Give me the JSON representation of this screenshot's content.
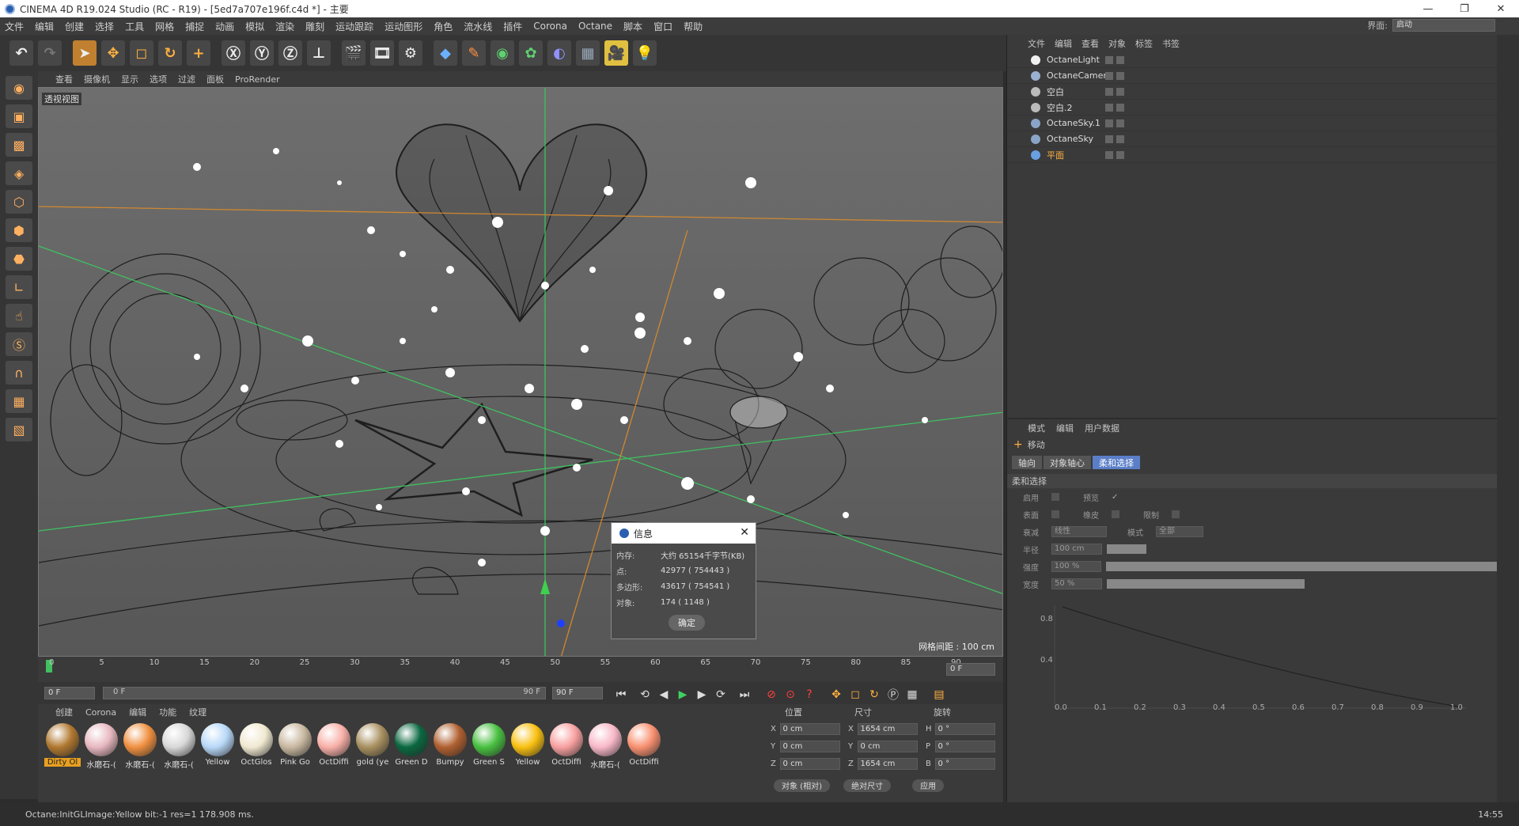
{
  "window": {
    "title": "CINEMA 4D R19.024 Studio (RC - R19) - [5ed7a707e196f.c4d *] - 主要"
  },
  "menubar": [
    "文件",
    "编辑",
    "创建",
    "选择",
    "工具",
    "网格",
    "捕捉",
    "动画",
    "模拟",
    "渲染",
    "雕刻",
    "运动跟踪",
    "运动图形",
    "角色",
    "流水线",
    "插件",
    "Corona",
    "Octane",
    "脚本",
    "窗口",
    "帮助"
  ],
  "layout": {
    "label": "界面:",
    "value": "启动"
  },
  "viewport": {
    "menu": [
      "查看",
      "摄像机",
      "显示",
      "选项",
      "过滤",
      "面板",
      "ProRender"
    ],
    "label": "透视视图",
    "grid_spacing": "网格间距 : 100 cm"
  },
  "info_dialog": {
    "title": "信息",
    "rows": [
      {
        "key": "内存:",
        "value": "大约 65154千字节(KB)"
      },
      {
        "key": "点:",
        "value": "42977 ( 754443 )"
      },
      {
        "key": "多边形:",
        "value": "43617 ( 754541 )"
      },
      {
        "key": "对象:",
        "value": "174 ( 1148 )"
      }
    ],
    "ok": "确定"
  },
  "timeline": {
    "ticks": [
      "0",
      "5",
      "10",
      "15",
      "20",
      "25",
      "30",
      "35",
      "40",
      "45",
      "50",
      "55",
      "60",
      "65",
      "70",
      "75",
      "80",
      "85",
      "90"
    ],
    "current": "0 F",
    "start": "0 F",
    "range_start": "0 F",
    "range_end": "90 F",
    "end": "90 F"
  },
  "materials": {
    "menu": [
      "创建",
      "Corona",
      "编辑",
      "功能",
      "纹理"
    ],
    "items": [
      {
        "name": "Dirty Ol",
        "color": "#b07830"
      },
      {
        "name": "水磨石-(",
        "color": "#e8b8c0"
      },
      {
        "name": "水磨石-(",
        "color": "#f09040"
      },
      {
        "name": "水磨石-(",
        "color": "#d8d8d8"
      },
      {
        "name": "Yellow",
        "color": "#b8d8f8"
      },
      {
        "name": "OctGlos",
        "color": "#f0e8d0"
      },
      {
        "name": "Pink Go",
        "color": "#c8b8a0"
      },
      {
        "name": "OctDiffi",
        "color": "#f8b0a8"
      },
      {
        "name": "gold (ye",
        "color": "#a89060"
      },
      {
        "name": "Green D",
        "color": "#0a6840"
      },
      {
        "name": "Bumpy",
        "color": "#b06030"
      },
      {
        "name": "Green S",
        "color": "#48c040"
      },
      {
        "name": "Yellow",
        "color": "#f8c010"
      },
      {
        "name": "OctDiffi",
        "color": "#f8a0a0"
      },
      {
        "name": "水磨石-(",
        "color": "#f8b8c8"
      },
      {
        "name": "OctDiffi",
        "color": "#f89070"
      }
    ]
  },
  "coords": {
    "headers": [
      "位置",
      "尺寸",
      "旋转"
    ],
    "rows": [
      {
        "a": "X",
        "pos": "0 cm",
        "b": "X",
        "size": "1654 cm",
        "c": "H",
        "rot": "0 °"
      },
      {
        "a": "Y",
        "pos": "0 cm",
        "b": "Y",
        "size": "0 cm",
        "c": "P",
        "rot": "0 °"
      },
      {
        "a": "Z",
        "pos": "0 cm",
        "b": "Z",
        "size": "1654 cm",
        "c": "B",
        "rot": "0 °"
      }
    ],
    "mode1": "对象 (相对)",
    "mode2": "绝对尺寸",
    "apply": "应用"
  },
  "status": "Octane:InitGLImage:Yellow  bit:-1 res=1  178.908 ms.",
  "object_manager": {
    "menu": [
      "文件",
      "编辑",
      "查看",
      "对象",
      "标签",
      "书签"
    ],
    "objects": [
      {
        "name": "OctaneLight",
        "color": "#f0f0f0"
      },
      {
        "name": "OctaneCamera",
        "color": "#9ab0d0"
      },
      {
        "name": "空白",
        "color": "#bbbbbb"
      },
      {
        "name": "空白.2",
        "color": "#bbbbbb"
      },
      {
        "name": "OctaneSky.1",
        "color": "#8aa4c8"
      },
      {
        "name": "OctaneSky",
        "color": "#8aa4c8"
      },
      {
        "name": "平面",
        "color": "#6aa0e0"
      }
    ]
  },
  "attr_manager": {
    "menu": [
      "模式",
      "编辑",
      "用户数据"
    ],
    "tool": "移动",
    "tabs": [
      "轴向",
      "对象轴心",
      "柔和选择"
    ],
    "section": "柔和选择",
    "rows": [
      {
        "l1": "启用",
        "l2": "预览"
      },
      {
        "l1": "表面",
        "l2": "橡皮",
        "l3": "限制"
      }
    ],
    "falloff_label": "衰减",
    "falloff": "线性",
    "mode_label": "模式",
    "mode": "全部",
    "radius_label": "半径",
    "radius": "100 cm",
    "strength_label": "强度",
    "strength": "100 %",
    "width_label": "宽度",
    "width": "50 %",
    "graph_y": [
      "0.8",
      "0.4"
    ],
    "graph_x": [
      "0.0",
      "0.1",
      "0.2",
      "0.3",
      "0.4",
      "0.5",
      "0.6",
      "0.7",
      "0.8",
      "0.9",
      "1.0"
    ]
  },
  "clock": "14:55"
}
